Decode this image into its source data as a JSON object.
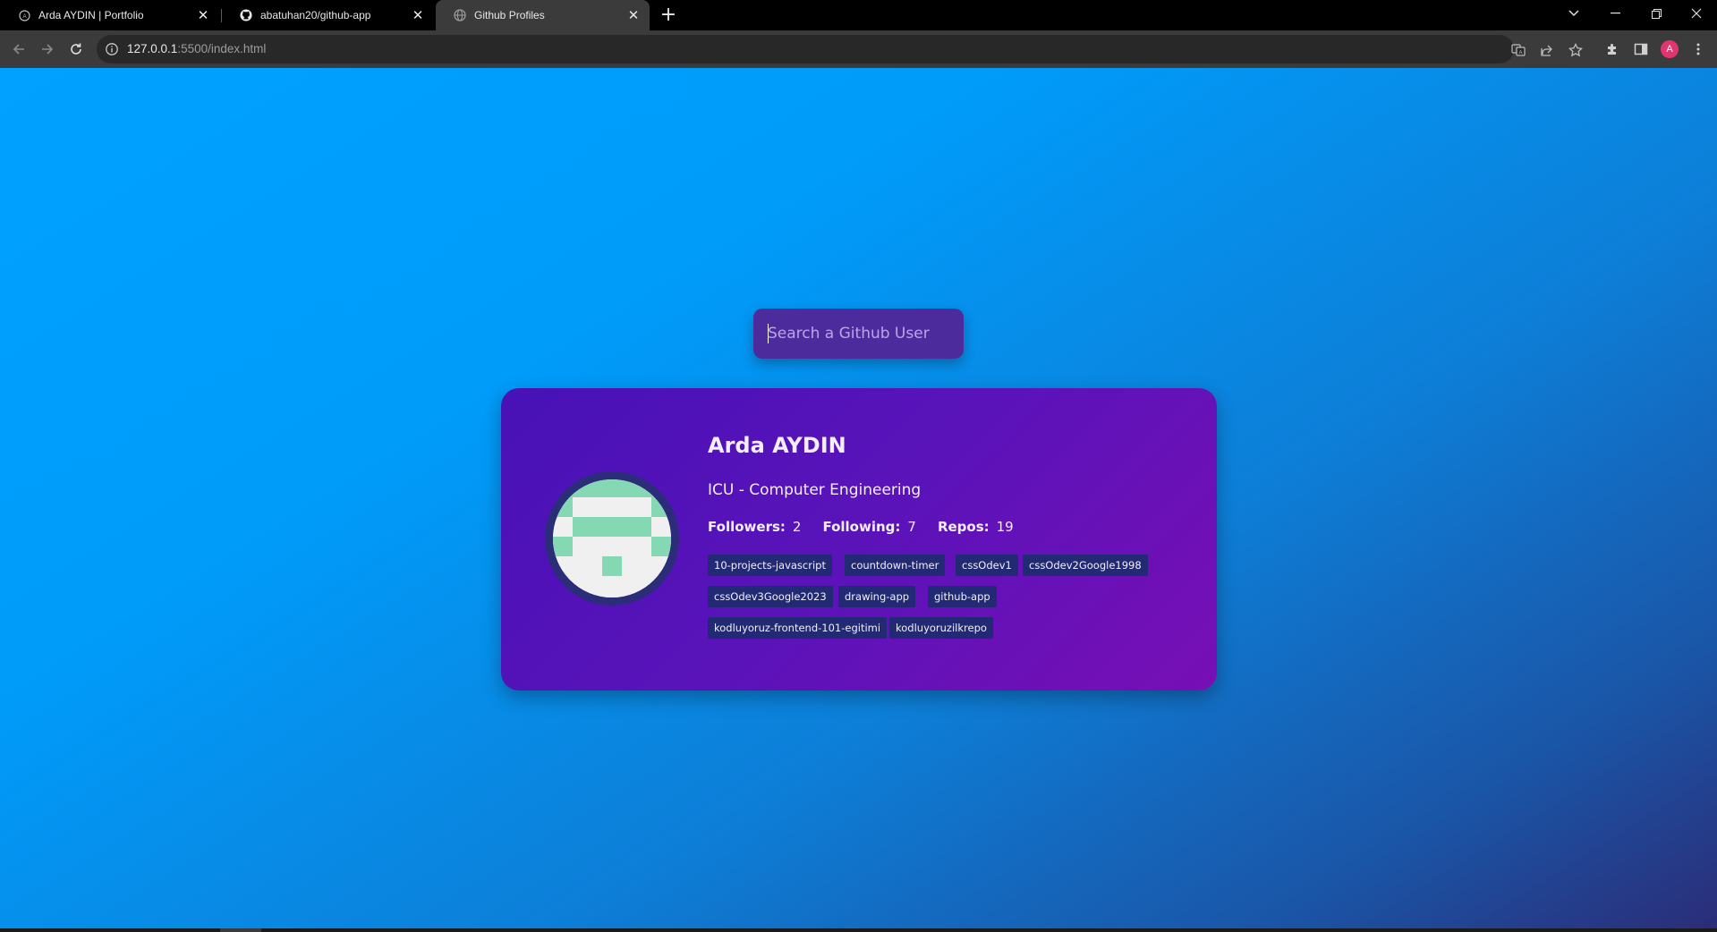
{
  "browser": {
    "tabs": [
      {
        "title": "Arda AYDIN | Portfolio",
        "icon": "portfolio-favicon",
        "active": false
      },
      {
        "title": "abatuhan20/github-app",
        "icon": "github-favicon",
        "active": false
      },
      {
        "title": "Github Profiles",
        "icon": "globe-favicon",
        "active": true
      }
    ],
    "url_host": "127.0.0.1",
    "url_path": ":5500/index.html",
    "profile_initial": "A",
    "profile_color": "#e0356f"
  },
  "page": {
    "search": {
      "placeholder": "Search a Github User",
      "value": ""
    },
    "card": {
      "name": "Arda AYDIN",
      "bio": "ICU - Computer Engineering",
      "stats": {
        "followers_label": "Followers:",
        "followers": "2",
        "following_label": "Following:",
        "following": "7",
        "repos_label": "Repos:",
        "repos": "19"
      },
      "repos": [
        "10-projects-javascript",
        "countdown-timer",
        "cssOdev1",
        "cssOdev2Google1998",
        "cssOdev3Google2023",
        "drawing-app",
        "github-app",
        "kodluyoruz-frontend-101-egitimi",
        "kodluyoruzilkrepo"
      ]
    }
  },
  "colors": {
    "card_start": "#4712b7",
    "card_end": "#770fb5",
    "repo_bg": "#212a72",
    "avatar_ring": "#2b2d78",
    "identicon_fg": "#85d8b4"
  }
}
